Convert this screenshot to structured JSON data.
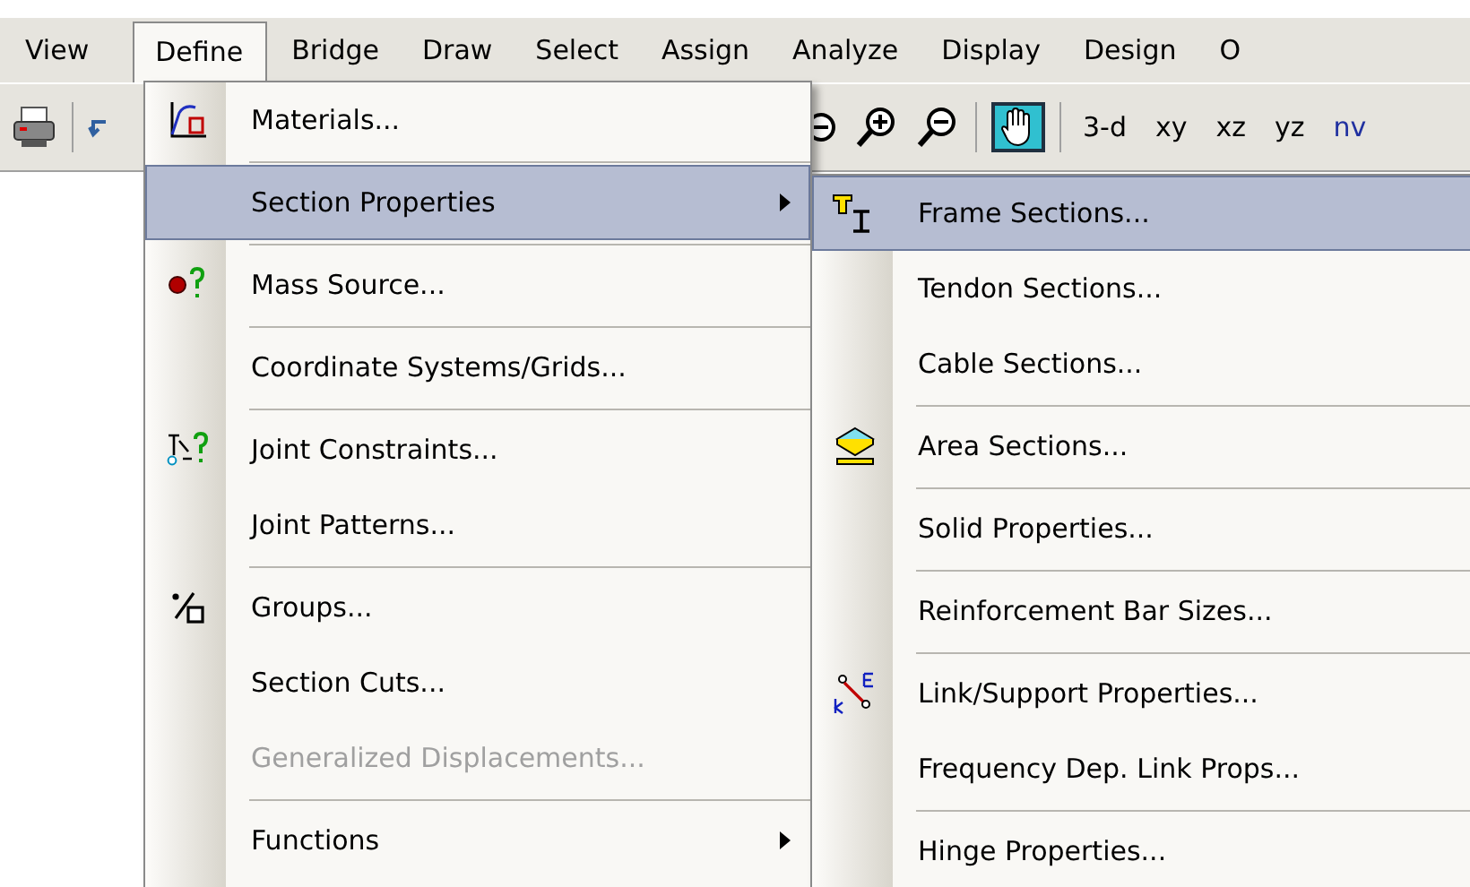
{
  "menubar": [
    {
      "label": "View",
      "selected": false
    },
    {
      "label": "Define",
      "selected": true
    },
    {
      "label": "Bridge",
      "selected": false
    },
    {
      "label": "Draw",
      "selected": false
    },
    {
      "label": "Select",
      "selected": false
    },
    {
      "label": "Assign",
      "selected": false
    },
    {
      "label": "Analyze",
      "selected": false
    },
    {
      "label": "Display",
      "selected": false
    },
    {
      "label": "Design",
      "selected": false
    },
    {
      "label": "O",
      "selected": false
    }
  ],
  "toolbar": {
    "pan_pressed": true,
    "view_buttons": [
      "3-d",
      "xy",
      "xz",
      "yz",
      "nv"
    ]
  },
  "define_menu": [
    {
      "kind": "item",
      "label": "Materials...",
      "selected": false,
      "disabled": false,
      "submenu": false
    },
    {
      "kind": "separator"
    },
    {
      "kind": "item",
      "label": "Section Properties",
      "selected": true,
      "disabled": false,
      "submenu": true
    },
    {
      "kind": "separator"
    },
    {
      "kind": "item",
      "label": "Mass  Source...",
      "selected": false,
      "disabled": false,
      "submenu": false
    },
    {
      "kind": "separator"
    },
    {
      "kind": "item",
      "label": "Coordinate Systems/Grids...",
      "selected": false,
      "disabled": false,
      "submenu": false
    },
    {
      "kind": "separator"
    },
    {
      "kind": "item",
      "label": "Joint Constraints...",
      "selected": false,
      "disabled": false,
      "submenu": false
    },
    {
      "kind": "item",
      "label": "Joint Patterns...",
      "selected": false,
      "disabled": false,
      "submenu": false
    },
    {
      "kind": "separator"
    },
    {
      "kind": "item",
      "label": "Groups...",
      "selected": false,
      "disabled": false,
      "submenu": false
    },
    {
      "kind": "item",
      "label": "Section Cuts...",
      "selected": false,
      "disabled": false,
      "submenu": false
    },
    {
      "kind": "item",
      "label": "Generalized Displacements...",
      "selected": false,
      "disabled": true,
      "submenu": false
    },
    {
      "kind": "separator"
    },
    {
      "kind": "item",
      "label": "Functions",
      "selected": false,
      "disabled": false,
      "submenu": true
    }
  ],
  "section_properties_menu": [
    {
      "kind": "item",
      "label": "Frame Sections...",
      "selected": true,
      "disabled": false,
      "submenu": false
    },
    {
      "kind": "item",
      "label": "Tendon Sections...",
      "selected": false,
      "disabled": false,
      "submenu": false
    },
    {
      "kind": "item",
      "label": "Cable Sections...",
      "selected": false,
      "disabled": false,
      "submenu": false
    },
    {
      "kind": "separator"
    },
    {
      "kind": "item",
      "label": "Area Sections...",
      "selected": false,
      "disabled": false,
      "submenu": false
    },
    {
      "kind": "separator"
    },
    {
      "kind": "item",
      "label": "Solid Properties...",
      "selected": false,
      "disabled": false,
      "submenu": false
    },
    {
      "kind": "separator"
    },
    {
      "kind": "item",
      "label": "Reinforcement Bar Sizes...",
      "selected": false,
      "disabled": false,
      "submenu": false
    },
    {
      "kind": "separator"
    },
    {
      "kind": "item",
      "label": "Link/Support Properties...",
      "selected": false,
      "disabled": false,
      "submenu": false
    },
    {
      "kind": "item",
      "label": "Frequency Dep. Link Props...",
      "selected": false,
      "disabled": false,
      "submenu": false
    },
    {
      "kind": "separator"
    },
    {
      "kind": "item",
      "label": "Hinge Properties...",
      "selected": false,
      "disabled": false,
      "submenu": false
    }
  ]
}
